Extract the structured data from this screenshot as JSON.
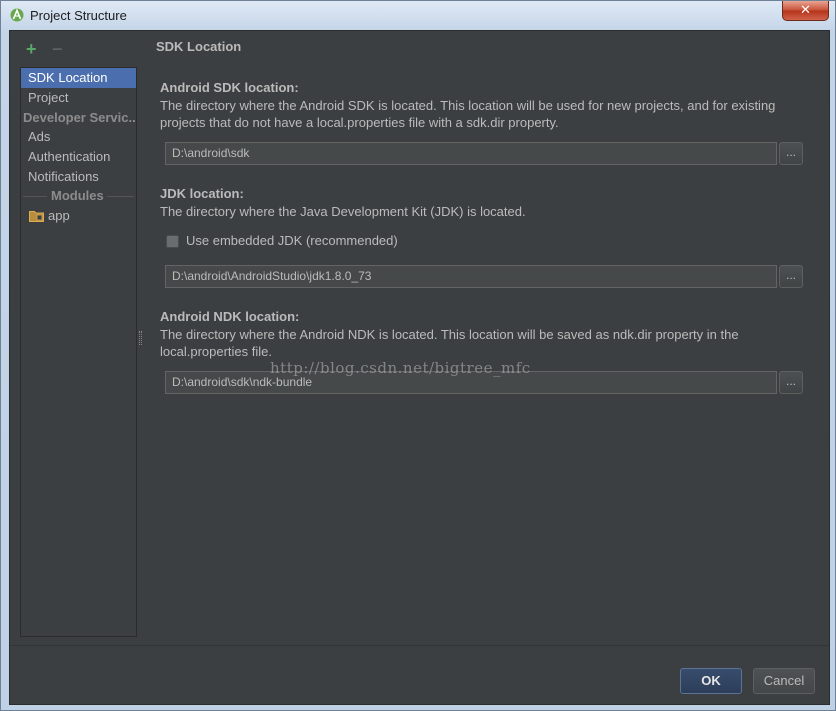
{
  "window": {
    "title": "Project Structure",
    "close_label": "✕"
  },
  "toolbar": {
    "add_label": "+",
    "remove_label": "−"
  },
  "sidebar": {
    "items": [
      {
        "label": "SDK Location",
        "selected": true
      },
      {
        "label": "Project"
      }
    ],
    "developer_services_header": "Developer Servic...",
    "developer_services": [
      {
        "label": "Ads"
      },
      {
        "label": "Authentication"
      },
      {
        "label": "Notifications"
      }
    ],
    "modules_header": "Modules",
    "modules": [
      {
        "label": "app"
      }
    ]
  },
  "main": {
    "section_title": "SDK Location",
    "android_sdk": {
      "label": "Android SDK location:",
      "description": "The directory where the Android SDK is located. This location will be used for new projects, and for existing projects that do not have a local.properties file with a sdk.dir property.",
      "value": "D:\\android\\sdk"
    },
    "jdk": {
      "label": "JDK location:",
      "description": "The directory where the Java Development Kit (JDK) is located.",
      "embedded_label": "Use embedded JDK (recommended)",
      "embedded_checked": false,
      "value": "D:\\android\\AndroidStudio\\jdk1.8.0_73"
    },
    "android_ndk": {
      "label": "Android NDK location:",
      "description": "The directory where the Android NDK is located. This location will be saved as ndk.dir property in the local.properties file.",
      "value": "D:\\android\\sdk\\ndk-bundle"
    },
    "browse_label": "...",
    "watermark": "http://blog.csdn.net/bigtree_mfc"
  },
  "footer": {
    "ok_label": "OK",
    "cancel_label": "Cancel"
  },
  "colors": {
    "background": "#3c3f41",
    "selection": "#4b6eaf",
    "text": "#bbbbbb",
    "add_icon": "#59a869"
  }
}
